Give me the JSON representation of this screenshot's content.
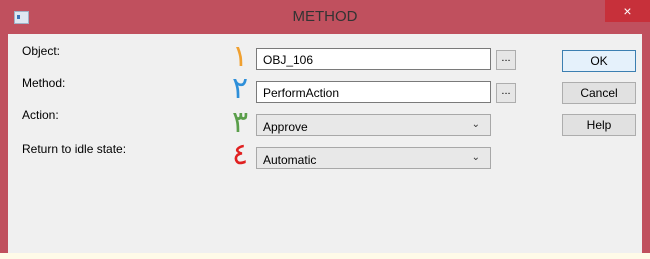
{
  "window": {
    "title": "METHOD",
    "close_glyph": "×",
    "accent_color": "#c0505e"
  },
  "form": {
    "rows": [
      {
        "label": "Object:",
        "value": "OBJ_106",
        "marker": "١",
        "marker_color": "#f0a030"
      },
      {
        "label": "Method:",
        "value": "PerformAction",
        "marker": "٢",
        "marker_color": "#2e8fd9"
      },
      {
        "label": "Action:",
        "value": "Approve",
        "marker": "٣",
        "marker_color": "#5a9e4a"
      },
      {
        "label": "Return to idle state:",
        "value": "Automatic",
        "marker": "٤",
        "marker_color": "#e02020"
      }
    ],
    "browse_label": "..."
  },
  "buttons": {
    "ok": "OK",
    "cancel": "Cancel",
    "help": "Help"
  }
}
